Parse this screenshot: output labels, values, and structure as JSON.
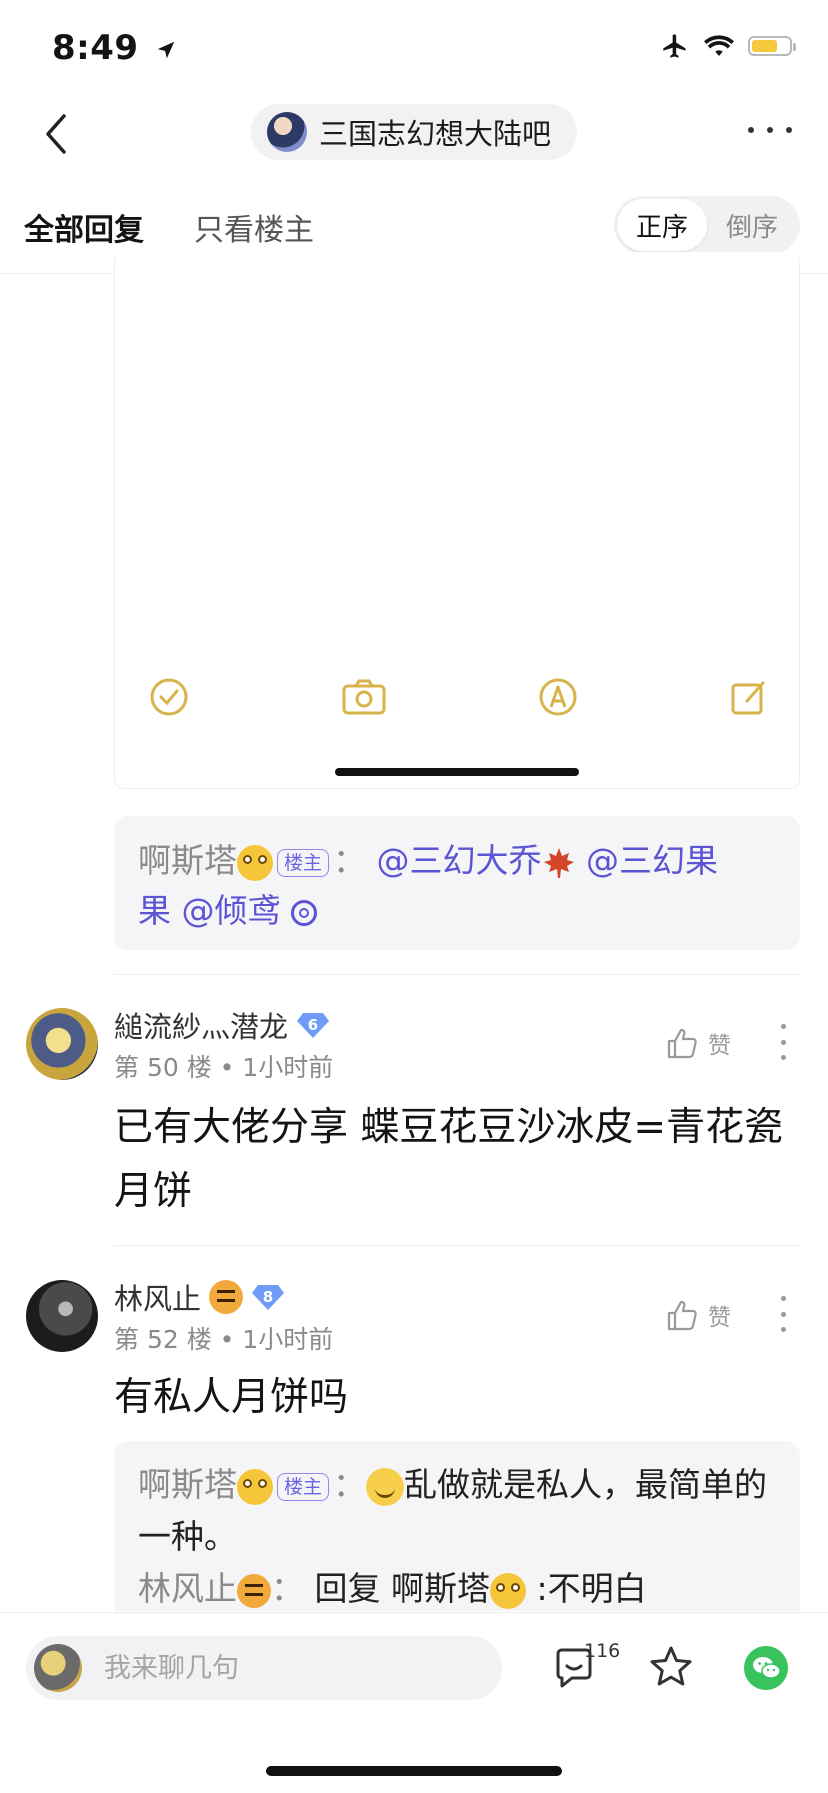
{
  "status_bar": {
    "time": "8:49"
  },
  "nav": {
    "forum_name": "三国志幻想大陆吧"
  },
  "filter": {
    "tab_all": "全部回复",
    "tab_owner_only": "只看楼主",
    "sort_asc": "正序",
    "sort_desc": "倒序",
    "active_sort": "正序"
  },
  "quote_top": {
    "author": "啊斯塔",
    "owner_badge": "楼主",
    "colon": "：",
    "mention1": "@三幻大乔",
    "mention2_line1": "@三幻果",
    "mention2_line2": "果",
    "mention3": "@倾鸢"
  },
  "posts": [
    {
      "user": "縋流紗灬潜龙",
      "level": "6",
      "floor": "第 50 楼",
      "time": "1小时前",
      "like_label": "赞",
      "content": "已有大佬分享 蝶豆花豆沙冰皮=青花瓷月饼"
    },
    {
      "user": "林风止",
      "level": "8",
      "floor": "第 52 楼",
      "time": "1小时前",
      "like_label": "赞",
      "content": "有私人月饼吗",
      "replies": {
        "r1_author": "啊斯塔",
        "r1_badge": "楼主",
        "r1_colon": "：",
        "r1_text": "乱做就是私人，最简单的一种。",
        "r2_author": "林风止",
        "r2_colon": "：",
        "r2_prefix": "回复 啊斯塔",
        "r2_text": ":不明白"
      }
    }
  ],
  "bottom_bar": {
    "input_placeholder": "我来聊几句",
    "comment_count": "116"
  },
  "colors": {
    "accent_purple": "#5b55d6",
    "wechat_green": "#38c35d",
    "battery_yellow": "#f6c93c",
    "icon_gold": "#d8b349"
  }
}
